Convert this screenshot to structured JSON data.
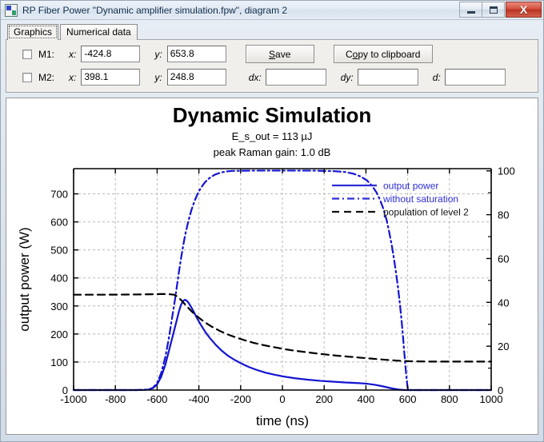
{
  "window": {
    "title": "RP Fiber Power \"Dynamic amplifier simulation.fpw\", diagram 2",
    "icon": "app-icon",
    "buttons": {
      "minimize": "minimize-icon",
      "maximize": "maximize-icon",
      "close": "X"
    }
  },
  "tabs": [
    {
      "label": "Graphics",
      "active": true
    },
    {
      "label": "Numerical data",
      "active": false
    }
  ],
  "controls": {
    "m1": {
      "name": "M1:",
      "checked": false,
      "x_label": "x:",
      "x_value": "-424.8",
      "y_label": "y:",
      "y_value": "653.8"
    },
    "m2": {
      "name": "M2:",
      "checked": false,
      "x_label": "x:",
      "x_value": "398.1",
      "y_label": "y:",
      "y_value": "248.8"
    },
    "save_button": "Save",
    "save_accel": "S",
    "copy_button": "Copy to clipboard",
    "copy_accel": "o",
    "dx_label": "dx:",
    "dx_value": "",
    "dy_label": "dy:",
    "dy_value": "",
    "d_label": "d:",
    "d_value": ""
  },
  "chart_data": {
    "type": "line",
    "title": "Dynamic Simulation",
    "subtitle1": "E_s_out = 113 µJ",
    "subtitle2": "peak Raman gain: 1.0 dB",
    "xlabel": "time (ns)",
    "ylabel": "output power (W)",
    "ylabel_right": "",
    "xlim": [
      -1000,
      1000
    ],
    "ylim": [
      0,
      790
    ],
    "ylim_right": [
      0,
      101
    ],
    "xticks": [
      -1000,
      -800,
      -600,
      -400,
      -200,
      0,
      200,
      400,
      600,
      800,
      1000
    ],
    "yticks": [
      0,
      100,
      200,
      300,
      400,
      500,
      600,
      700
    ],
    "yticks_right": [
      0,
      20,
      40,
      60,
      80,
      100
    ],
    "grid": true,
    "legend_position": "upper right",
    "colors": {
      "output_power": "#1414d2",
      "without_saturation": "#1414d2",
      "population": "#000000"
    },
    "series": [
      {
        "name": "output power",
        "axis": "left",
        "style": "solid",
        "color": "#1414d2",
        "points": [
          [
            -1000,
            0
          ],
          [
            -900,
            0
          ],
          [
            -800,
            0
          ],
          [
            -700,
            0
          ],
          [
            -660,
            0.5
          ],
          [
            -640,
            2
          ],
          [
            -620,
            7
          ],
          [
            -600,
            20
          ],
          [
            -580,
            48
          ],
          [
            -560,
            92
          ],
          [
            -540,
            150
          ],
          [
            -520,
            208
          ],
          [
            -505,
            252
          ],
          [
            -495,
            282
          ],
          [
            -485,
            305
          ],
          [
            -475,
            318
          ],
          [
            -468,
            322
          ],
          [
            -460,
            320
          ],
          [
            -450,
            312
          ],
          [
            -440,
            300
          ],
          [
            -425,
            280
          ],
          [
            -410,
            258
          ],
          [
            -390,
            232
          ],
          [
            -370,
            208
          ],
          [
            -350,
            188
          ],
          [
            -320,
            162
          ],
          [
            -290,
            140
          ],
          [
            -260,
            122
          ],
          [
            -230,
            108
          ],
          [
            -200,
            96
          ],
          [
            -160,
            82
          ],
          [
            -120,
            71
          ],
          [
            -80,
            62
          ],
          [
            -40,
            55
          ],
          [
            0,
            49
          ],
          [
            60,
            42
          ],
          [
            120,
            37
          ],
          [
            180,
            33
          ],
          [
            240,
            30
          ],
          [
            300,
            27
          ],
          [
            360,
            25
          ],
          [
            400,
            23
          ],
          [
            440,
            19
          ],
          [
            470,
            15
          ],
          [
            500,
            10
          ],
          [
            530,
            5
          ],
          [
            560,
            1.5
          ],
          [
            580,
            0.3
          ],
          [
            600,
            0
          ],
          [
            700,
            0
          ],
          [
            800,
            0
          ],
          [
            900,
            0
          ],
          [
            1000,
            0
          ]
        ]
      },
      {
        "name": "without saturation",
        "axis": "left",
        "style": "dashdot",
        "color": "#1414d2",
        "points": [
          [
            -1000,
            0
          ],
          [
            -700,
            0
          ],
          [
            -640,
            2
          ],
          [
            -620,
            8
          ],
          [
            -600,
            25
          ],
          [
            -580,
            62
          ],
          [
            -560,
            120
          ],
          [
            -545,
            180
          ],
          [
            -530,
            250
          ],
          [
            -515,
            320
          ],
          [
            -505,
            372
          ],
          [
            -495,
            424
          ],
          [
            -485,
            472
          ],
          [
            -475,
            516
          ],
          [
            -465,
            556
          ],
          [
            -450,
            604
          ],
          [
            -435,
            644
          ],
          [
            -420,
            676
          ],
          [
            -405,
            702
          ],
          [
            -390,
            722
          ],
          [
            -370,
            742
          ],
          [
            -350,
            756
          ],
          [
            -325,
            768
          ],
          [
            -300,
            775
          ],
          [
            -270,
            780
          ],
          [
            -240,
            782
          ],
          [
            -150,
            783
          ],
          [
            0,
            783
          ],
          [
            150,
            783
          ],
          [
            250,
            781
          ],
          [
            300,
            778
          ],
          [
            340,
            772
          ],
          [
            375,
            762
          ],
          [
            405,
            748
          ],
          [
            430,
            728
          ],
          [
            450,
            706
          ],
          [
            468,
            678
          ],
          [
            485,
            644
          ],
          [
            500,
            604
          ],
          [
            512,
            562
          ],
          [
            524,
            516
          ],
          [
            534,
            470
          ],
          [
            544,
            420
          ],
          [
            554,
            364
          ],
          [
            562,
            312
          ],
          [
            570,
            254
          ],
          [
            577,
            196
          ],
          [
            583,
            140
          ],
          [
            589,
            88
          ],
          [
            594,
            46
          ],
          [
            598,
            18
          ],
          [
            601,
            4
          ],
          [
            604,
            0
          ],
          [
            700,
            0
          ],
          [
            1000,
            0
          ]
        ]
      },
      {
        "name": "population of level 2",
        "axis": "right",
        "style": "dashed",
        "color": "#000000",
        "points": [
          [
            -1000,
            43.5
          ],
          [
            -850,
            43.5
          ],
          [
            -700,
            43.6
          ],
          [
            -620,
            43.7
          ],
          [
            -580,
            43.8
          ],
          [
            -550,
            43.8
          ],
          [
            -520,
            43.5
          ],
          [
            -505,
            42.8
          ],
          [
            -495,
            42.0
          ],
          [
            -485,
            41.0
          ],
          [
            -475,
            40.0
          ],
          [
            -460,
            38.4
          ],
          [
            -440,
            36.4
          ],
          [
            -420,
            34.6
          ],
          [
            -400,
            33.0
          ],
          [
            -370,
            30.8
          ],
          [
            -340,
            29.0
          ],
          [
            -300,
            27.0
          ],
          [
            -260,
            25.3
          ],
          [
            -220,
            23.9
          ],
          [
            -180,
            22.7
          ],
          [
            -140,
            21.6
          ],
          [
            -100,
            20.7
          ],
          [
            -60,
            19.9
          ],
          [
            -20,
            19.2
          ],
          [
            20,
            18.5
          ],
          [
            70,
            17.8
          ],
          [
            120,
            17.2
          ],
          [
            170,
            16.6
          ],
          [
            220,
            16.1
          ],
          [
            270,
            15.6
          ],
          [
            320,
            15.2
          ],
          [
            370,
            14.8
          ],
          [
            420,
            14.4
          ],
          [
            470,
            14.0
          ],
          [
            520,
            13.6
          ],
          [
            570,
            13.3
          ],
          [
            620,
            13.1
          ],
          [
            700,
            13.0
          ],
          [
            800,
            13.0
          ],
          [
            900,
            13.0
          ],
          [
            1000,
            13.0
          ]
        ]
      }
    ],
    "legend": [
      {
        "label": "output power",
        "style": "solid",
        "color": "#2d2dd8"
      },
      {
        "label": "without saturation",
        "style": "dashdot",
        "color": "#2d2dd8"
      },
      {
        "label": "population of level 2",
        "style": "dashed",
        "color": "#111111"
      }
    ]
  }
}
